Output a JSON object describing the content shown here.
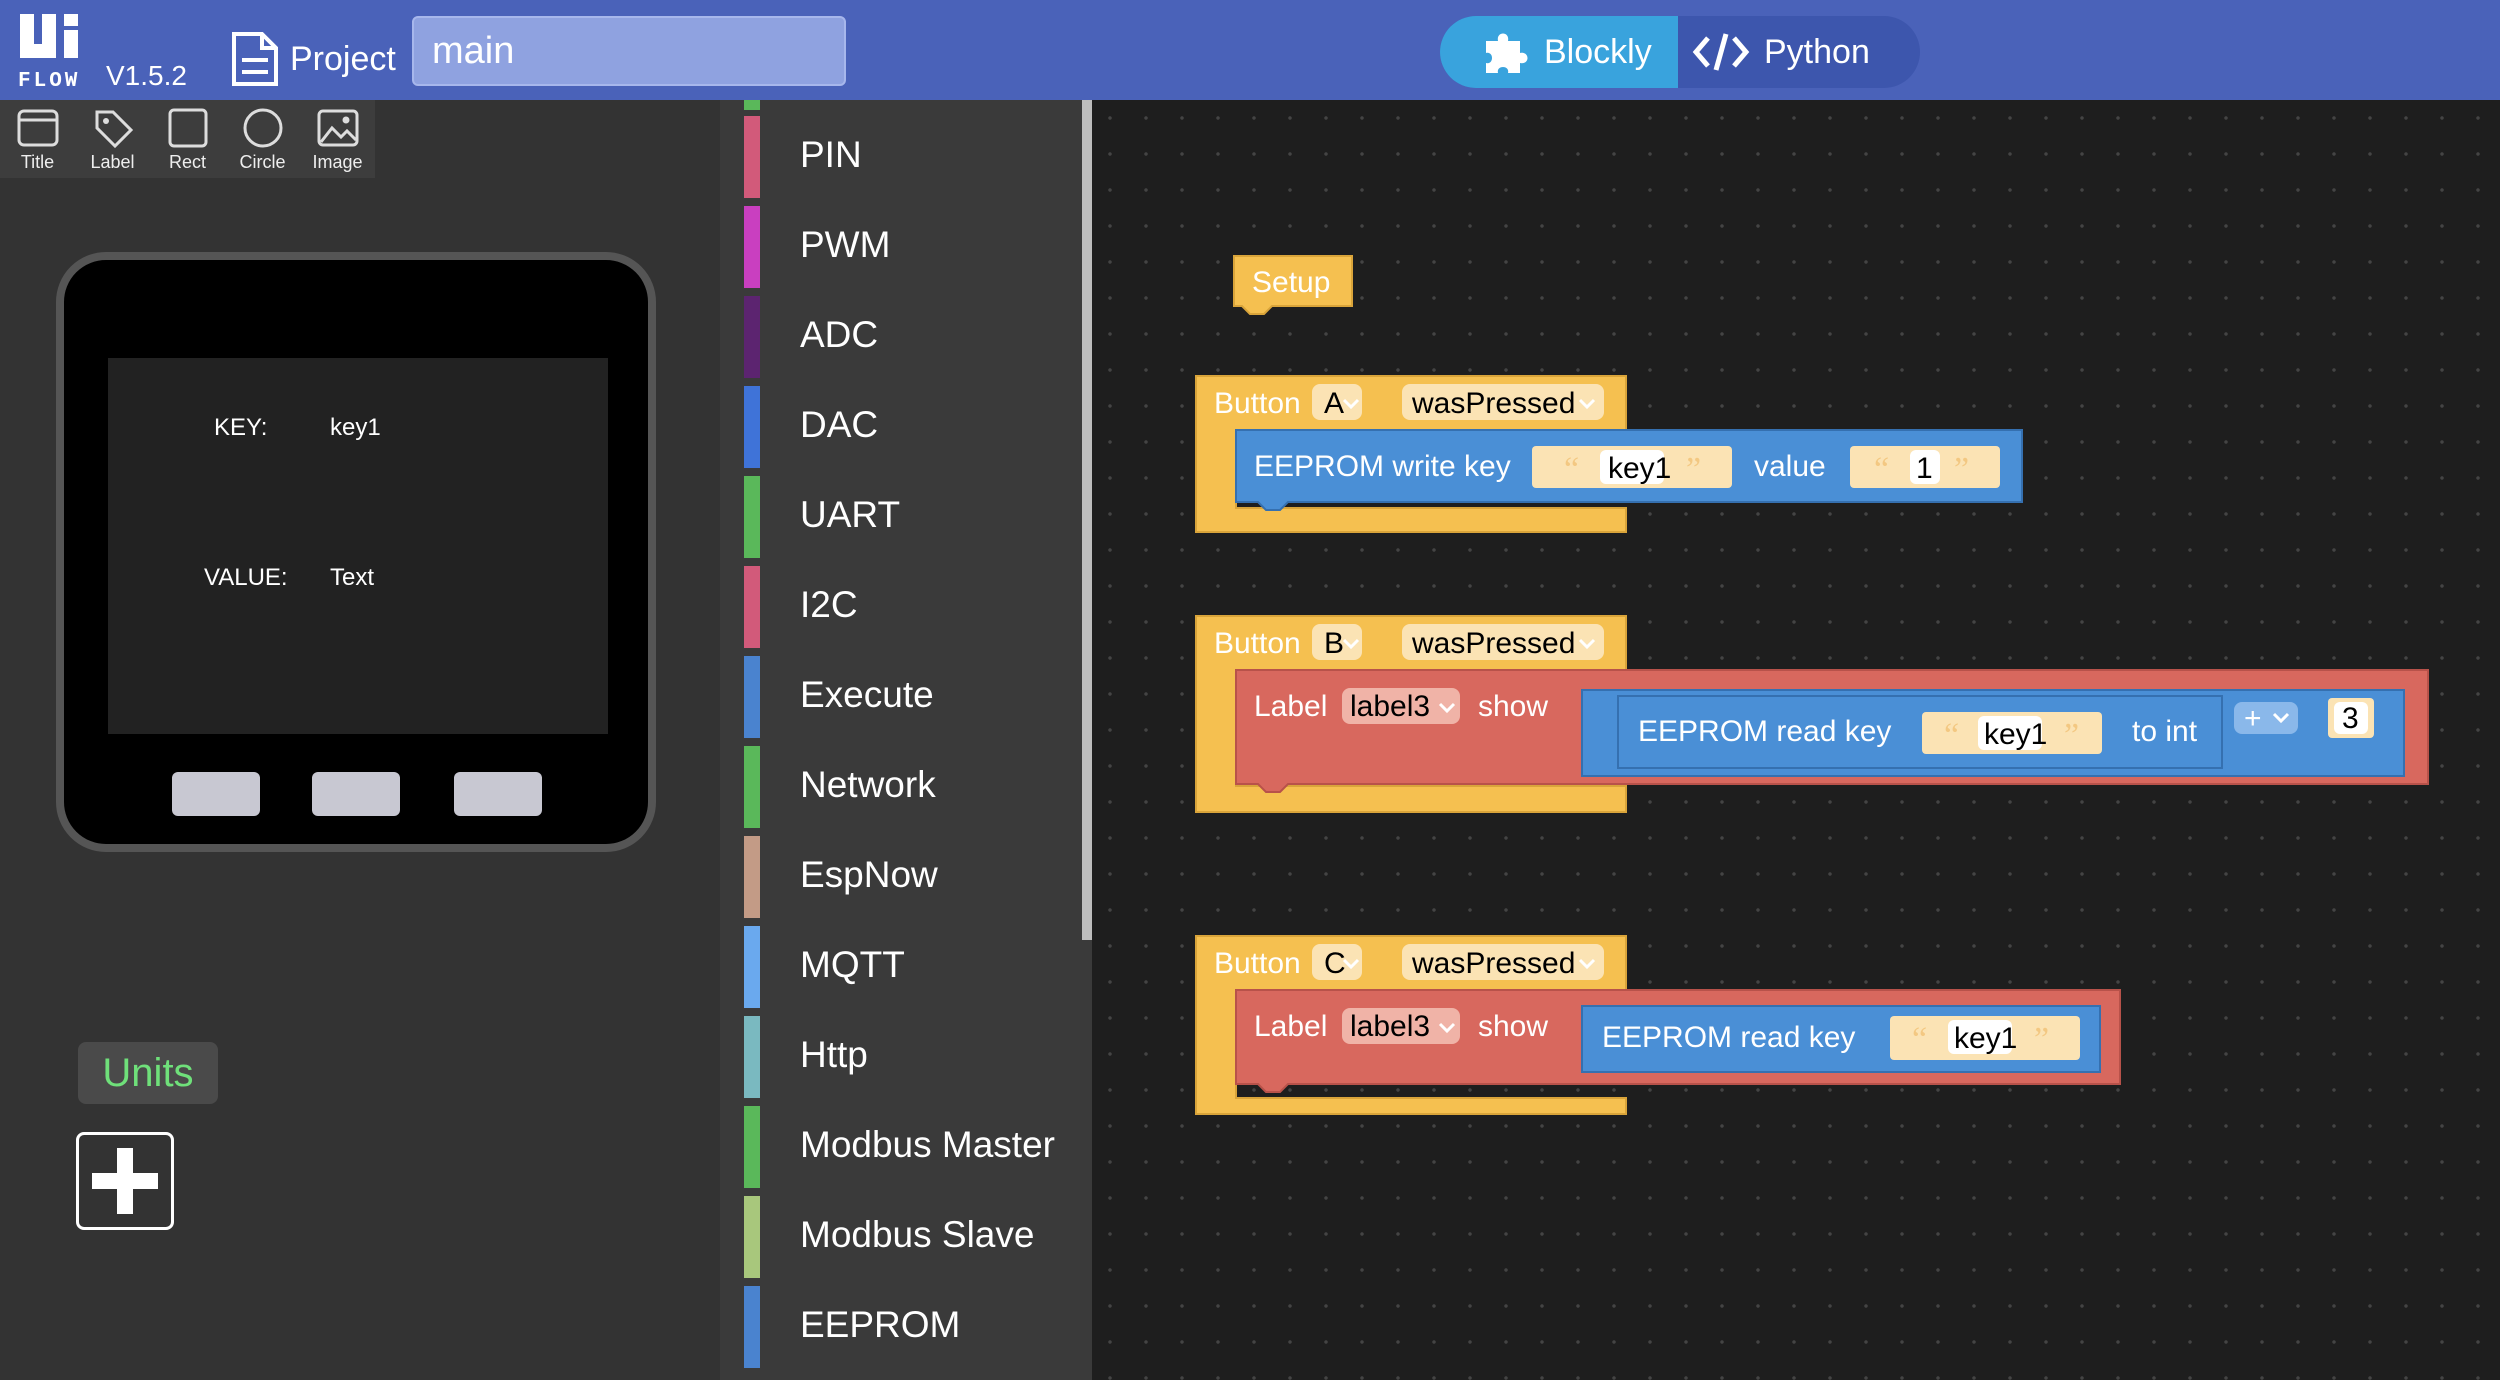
{
  "header": {
    "logo": "UiFlow",
    "version": "V1.5.2",
    "project_label": "Project",
    "file_name": "main",
    "modes": [
      {
        "label": "Blockly",
        "active": true,
        "icon": "puzzle-icon"
      },
      {
        "label": "Python",
        "active": false,
        "icon": "code-icon"
      }
    ]
  },
  "tools": [
    {
      "label": "Title",
      "icon": "title-icon"
    },
    {
      "label": "Label",
      "icon": "tag-icon"
    },
    {
      "label": "Rect",
      "icon": "rect-icon"
    },
    {
      "label": "Circle",
      "icon": "circle-icon"
    },
    {
      "label": "Image",
      "icon": "image-icon"
    }
  ],
  "device_screen": {
    "key_label": "KEY:",
    "key_value": "key1",
    "value_label": "VALUE:",
    "value_value": "Text"
  },
  "units": {
    "label": "Units"
  },
  "categories": [
    {
      "label": "PIN",
      "color": "#d25a7a"
    },
    {
      "label": "PWM",
      "color": "#c93fc0"
    },
    {
      "label": "ADC",
      "color": "#5c2470"
    },
    {
      "label": "DAC",
      "color": "#3f73d8"
    },
    {
      "label": "UART",
      "color": "#5ab85a"
    },
    {
      "label": "I2C",
      "color": "#d25a7a"
    },
    {
      "label": "Execute",
      "color": "#4a83cf"
    },
    {
      "label": "Network",
      "color": "#5ab85a"
    },
    {
      "label": "EspNow",
      "color": "#c39b86"
    },
    {
      "label": "MQTT",
      "color": "#6aa9ee"
    },
    {
      "label": "Http",
      "color": "#7ab9c0"
    },
    {
      "label": "Modbus Master",
      "color": "#5ab85a"
    },
    {
      "label": "Modbus Slave",
      "color": "#a8c77c"
    },
    {
      "label": "EEPROM",
      "color": "#4a83cf"
    }
  ],
  "blocks": {
    "colors": {
      "event": "#f5c050",
      "eeprom": "#4a8fd6",
      "label": "#d8685e",
      "field": "#fbe3b4"
    },
    "setup": {
      "label": "Setup"
    },
    "button_a": {
      "button_label": "Button",
      "button_id": "A",
      "event": "wasPressed",
      "action_label": "EEPROM write key",
      "key": "key1",
      "value_label": "value",
      "value": "1"
    },
    "button_b": {
      "button_label": "Button",
      "button_id": "B",
      "event": "wasPressed",
      "label_word": "Label",
      "label_name": "label3",
      "show": "show",
      "read_label": "EEPROM read key",
      "key": "key1",
      "to_int": "to int",
      "op": "+",
      "operand": "3"
    },
    "button_c": {
      "button_label": "Button",
      "button_id": "C",
      "event": "wasPressed",
      "label_word": "Label",
      "label_name": "label3",
      "show": "show",
      "read_label": "EEPROM read key",
      "key": "key1"
    },
    "quote_open": "“",
    "quote_close": "”"
  }
}
